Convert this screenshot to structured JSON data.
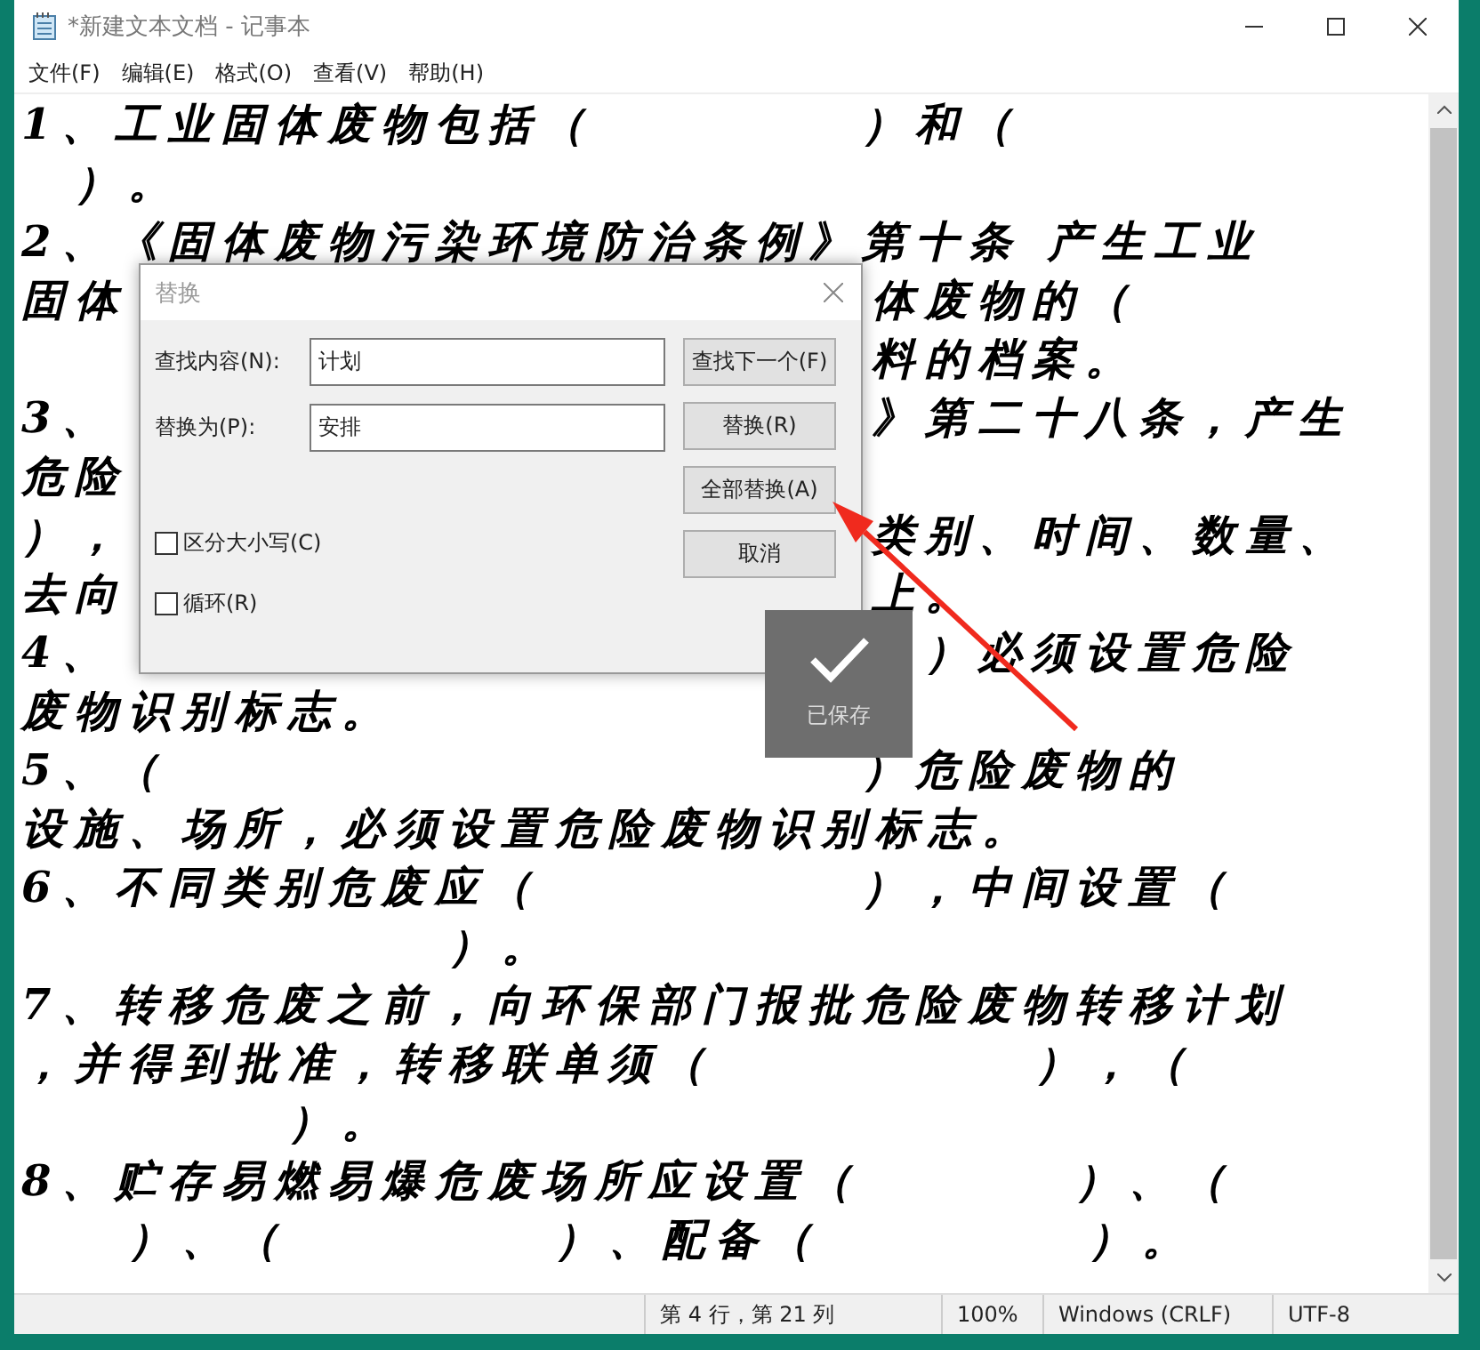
{
  "window": {
    "title": "*新建文本文档 - 记事本"
  },
  "menu": [
    "文件(F)",
    "编辑(E)",
    "格式(O)",
    "查看(V)",
    "帮助(H)"
  ],
  "editor": {
    "lines": [
      {
        "text": "1、工业固体废物包括（　　　　　）和（"
      },
      {
        "text": "　）。"
      },
      {
        "text": "2、《固体废物污染环境防治条例》第十条 产生工业"
      },
      {
        "left": "固体",
        "right": "体废物的（"
      },
      {
        "right": "料的档案。"
      },
      {
        "left": "3、",
        "right": "》第二十八条，产生"
      },
      {
        "left": "危险"
      },
      {
        "left": "），",
        "right": "类别、时间、数量、"
      },
      {
        "left": "去向",
        "right": "上。"
      },
      {
        "left": "4、",
        "right": "　）必须设置危险"
      },
      {
        "text": "废物识别标志。"
      },
      {
        "text": "5、（　　　　　　　　　　　　　）危险废物的"
      },
      {
        "text": "设施、场所，必须设置危险废物识别标志。"
      },
      {
        "text": "6、不同类别危废应（　　　　　　），中间设置（"
      },
      {
        "text": "　　　　　　　　）。"
      },
      {
        "text": "7、转移危废之前，向环保部门报批危险废物转移计划"
      },
      {
        "text": "，并得到批准，转移联单须（　　　　　　），（"
      },
      {
        "text": "　　　　　）。"
      },
      {
        "text": "8、贮存易燃易爆危废场所应设置（　　　　）、（"
      },
      {
        "text": "　　）、（　　　　　）、配备（　　　　　）。"
      }
    ]
  },
  "status_bar": [
    "第 4 行，第 21 列",
    "100%",
    "Windows (CRLF)",
    "UTF-8"
  ],
  "dialog": {
    "title": "替换",
    "fields": [
      {
        "label": "查找内容(N):",
        "value": "计划"
      },
      {
        "label": "替换为(P):",
        "value": "安排"
      }
    ],
    "buttons": [
      "查找下一个(F)",
      "替换(R)",
      "全部替换(A)",
      "取消"
    ],
    "checkboxes": [
      {
        "label": "区分大小写(C)",
        "checked": false
      },
      {
        "label": "循环(R)",
        "checked": false
      }
    ]
  },
  "toast": {
    "text": "已保存"
  }
}
